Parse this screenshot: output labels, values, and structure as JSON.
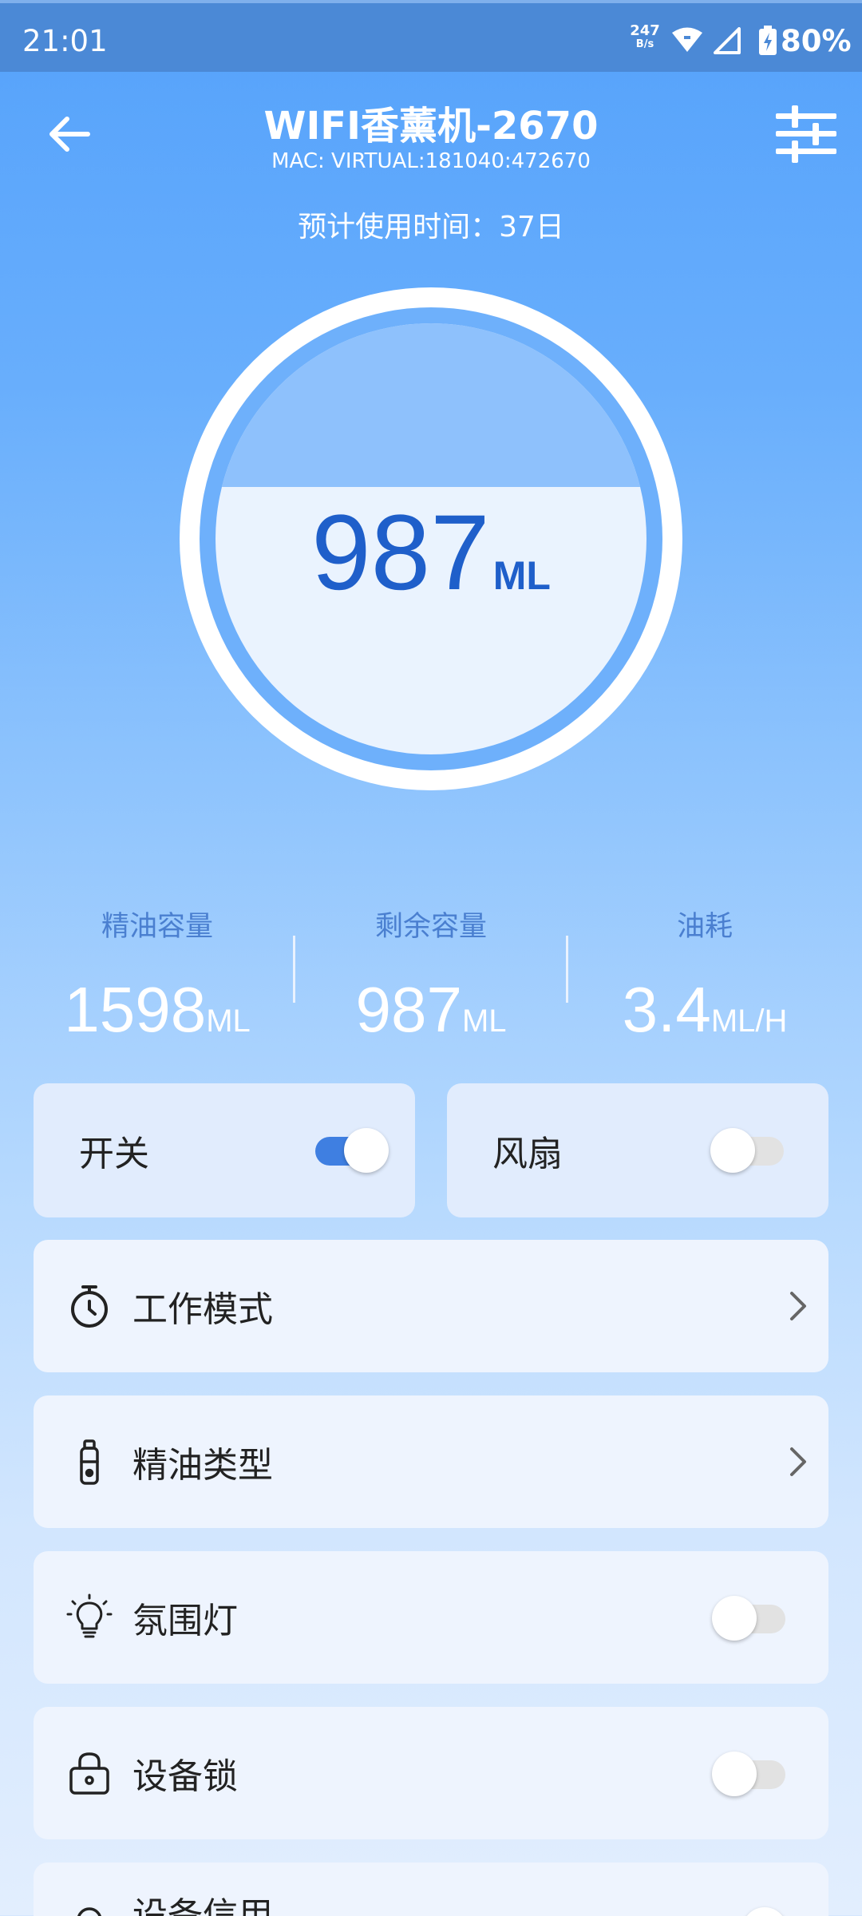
{
  "status_bar": {
    "time": "21:01",
    "net_speed": "247",
    "net_speed_unit": "B/s",
    "battery": "80%"
  },
  "header": {
    "title": "WIFI香薰机-2670",
    "mac": "MAC: VIRTUAL:181040:472670",
    "usage_estimate": "预计使用时间：37日"
  },
  "gauge": {
    "value": "987",
    "unit": "ML",
    "fill_fraction": 0.62
  },
  "stats": [
    {
      "label": "精油容量",
      "value": "1598",
      "unit": "ML"
    },
    {
      "label": "剩余容量",
      "value": "987",
      "unit": "ML"
    },
    {
      "label": "油耗",
      "value": "3.4",
      "unit": "ML/H"
    }
  ],
  "toggles": {
    "power": {
      "label": "开关",
      "on": true
    },
    "fan": {
      "label": "风扇",
      "on": false
    }
  },
  "rows": {
    "work_mode": {
      "label": "工作模式",
      "icon": "timer-icon"
    },
    "oil_type": {
      "label": "精油类型",
      "icon": "oil-bottle-icon"
    },
    "ambient_light": {
      "label": "氛围灯",
      "icon": "lightbulb-icon",
      "on": false
    },
    "device_lock": {
      "label": "设备锁",
      "icon": "lock-icon",
      "on": false
    },
    "partial": {
      "label": "设备信用",
      "on": true
    }
  },
  "colors": {
    "accent": "#3f7fe1",
    "gauge_text": "#1f5fca",
    "stat_label": "#4a7fd0",
    "card_bg": "#eef4fe"
  }
}
